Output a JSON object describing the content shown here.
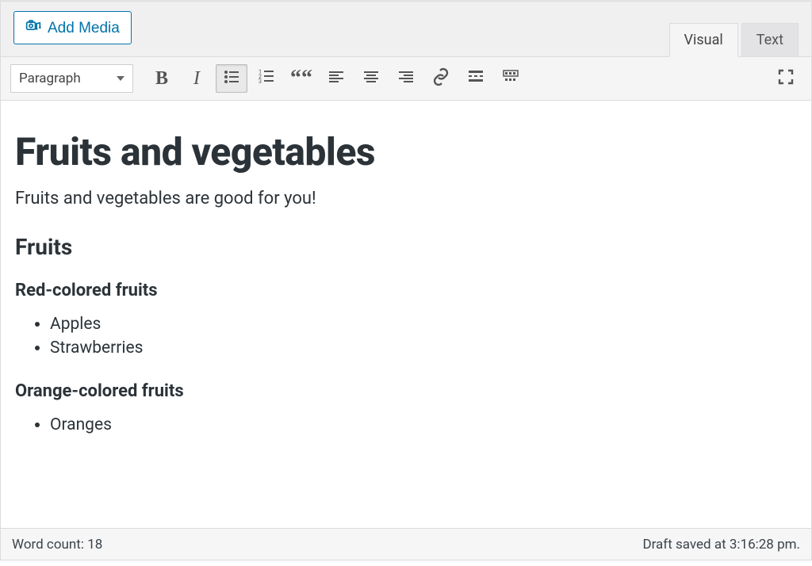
{
  "media_bar": {
    "add_media_label": "Add Media"
  },
  "tabs": {
    "visual": "Visual",
    "text": "Text"
  },
  "toolbar": {
    "format_selected": "Paragraph",
    "bold_glyph": "B",
    "italic_glyph": "I",
    "quote_glyph": "““"
  },
  "content": {
    "title": "Fruits and vegetables",
    "intro": "Fruits and vegetables are good for you!",
    "h2_1": "Fruits",
    "h3_1": "Red-colored fruits",
    "list1": {
      "0": "Apples",
      "1": "Strawberries"
    },
    "h3_2": "Orange-colored fruits",
    "list2": {
      "0": "Oranges"
    }
  },
  "status": {
    "wordcount_label": "Word count:",
    "wordcount_value": "18",
    "draft_saved": "Draft saved at 3:16:28 pm."
  }
}
